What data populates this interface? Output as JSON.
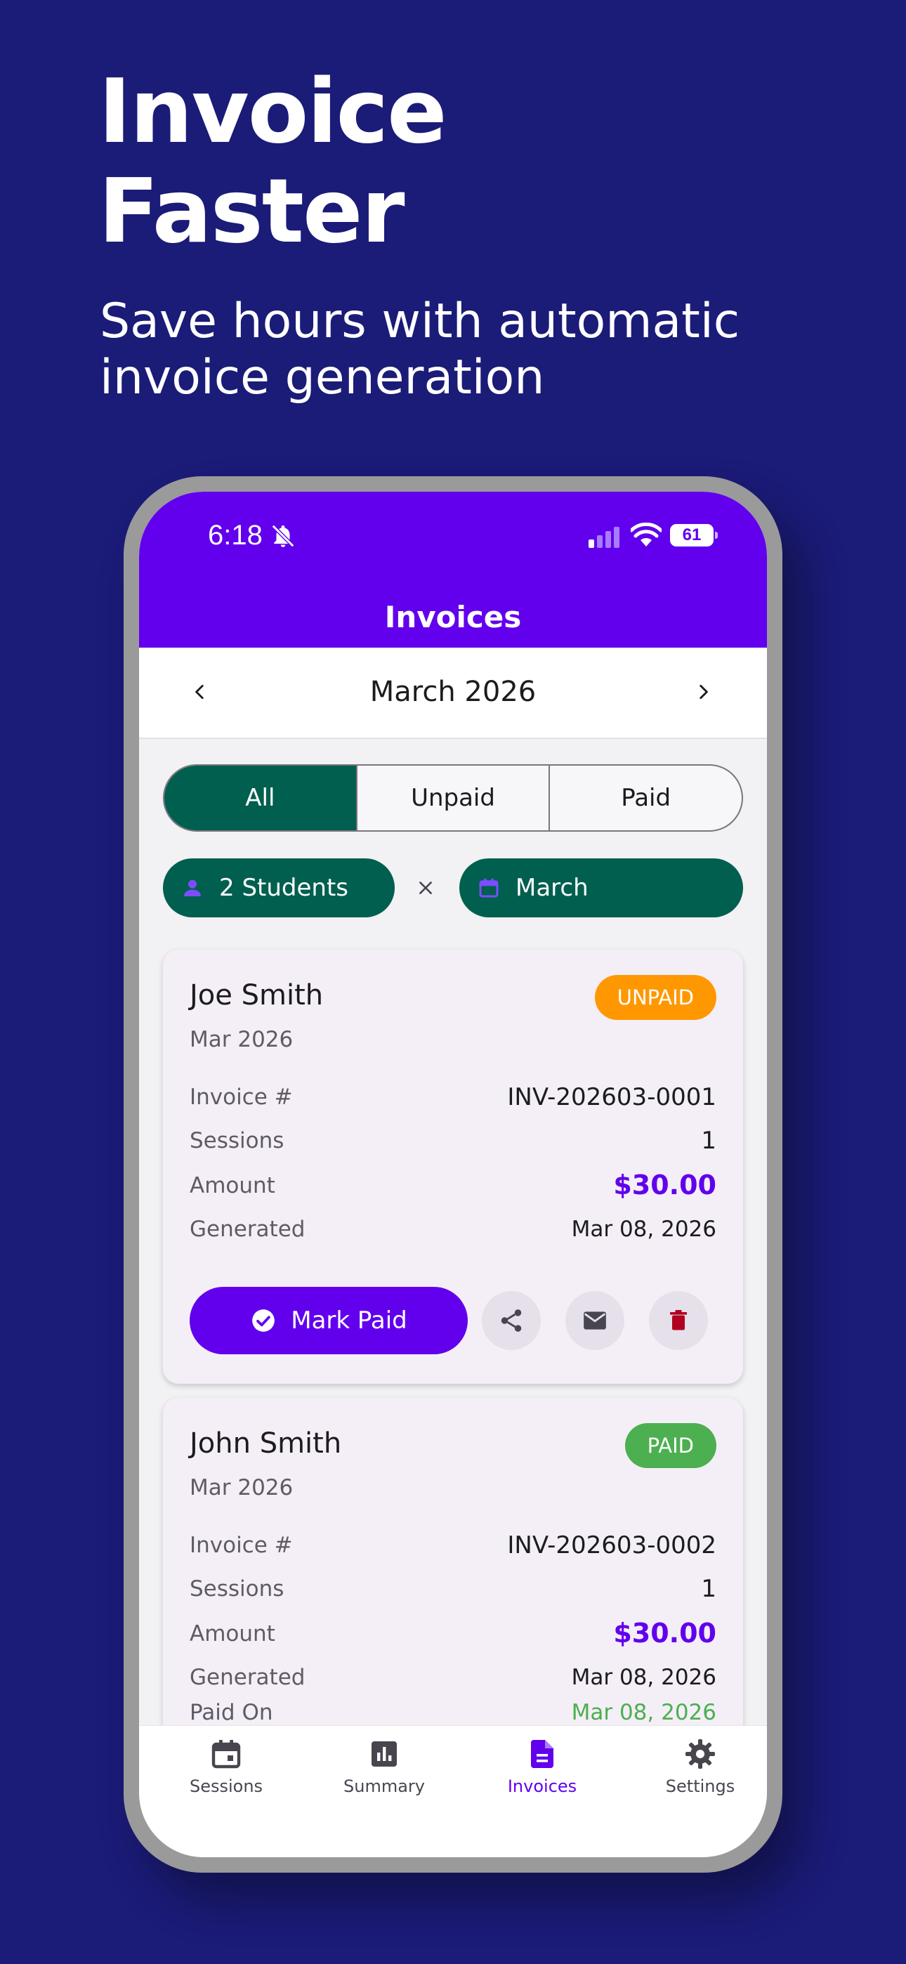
{
  "promo": {
    "title_line1": "Invoice",
    "title_line2": "Faster",
    "subtitle_line1": "Save hours with automatic",
    "subtitle_line2": "invoice generation"
  },
  "status_bar": {
    "time": "6:18",
    "battery": "61"
  },
  "app_bar": {
    "title": "Invoices"
  },
  "month_nav": {
    "label": "March 2026"
  },
  "filters": {
    "segments": [
      "All",
      "Unpaid",
      "Paid"
    ],
    "active_segment": "All",
    "chips": {
      "students": "2 Students",
      "clear": "×",
      "month": "March"
    }
  },
  "labels": {
    "invoice_no": "Invoice #",
    "sessions": "Sessions",
    "amount": "Amount",
    "generated": "Generated",
    "paid_on": "Paid On",
    "mark_paid": "Mark Paid"
  },
  "invoices": [
    {
      "student": "Joe Smith",
      "period": "Mar 2026",
      "status": "UNPAID",
      "invoice_number": "INV-202603-0001",
      "sessions": "1",
      "amount": "$30.00",
      "generated": "Mar 08, 2026"
    },
    {
      "student": "John Smith",
      "period": "Mar 2026",
      "status": "PAID",
      "invoice_number": "INV-202603-0002",
      "sessions": "1",
      "amount": "$30.00",
      "generated": "Mar 08, 2026",
      "paid_on": "Mar 08, 2026"
    }
  ],
  "bottom_nav": {
    "items": [
      {
        "label": "Sessions",
        "icon": "calendar-icon"
      },
      {
        "label": "Summary",
        "icon": "bar-chart-icon"
      },
      {
        "label": "Invoices",
        "icon": "document-icon"
      },
      {
        "label": "Settings",
        "icon": "gear-icon"
      }
    ],
    "active": "Invoices"
  },
  "colors": {
    "background": "#1b1b78",
    "primary": "#6200ee",
    "filter_green": "#005f4e",
    "unpaid": "#ff9800",
    "paid": "#4caf50",
    "delete": "#b00020"
  }
}
